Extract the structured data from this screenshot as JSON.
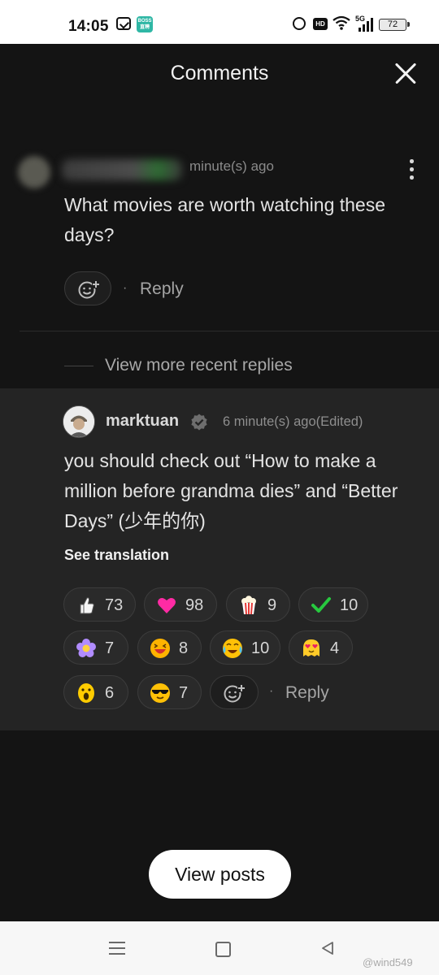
{
  "status_bar": {
    "time": "14:05",
    "boss_label": "BOSS 直聘",
    "hd_label": "HD",
    "signal_label": "5G",
    "battery": "72"
  },
  "header": {
    "title": "Comments"
  },
  "top_comment": {
    "time": "minute(s) ago",
    "text": "What movies are worth watching these days?",
    "reply_label": "Reply",
    "dot": "·"
  },
  "view_more": {
    "label": "View more recent replies"
  },
  "reply": {
    "username": "marktuan",
    "time": "6 minute(s) ago(Edited)",
    "text": "you should check out “How to make a million before grandma dies” and “Better Days” (少年的你)",
    "see_translation": "See translation",
    "reply_label": "Reply",
    "dot": "·",
    "reactions": [
      {
        "icon": "thumbs-up-icon",
        "count": "73"
      },
      {
        "icon": "heart-icon",
        "count": "98"
      },
      {
        "icon": "popcorn-icon",
        "count": "9"
      },
      {
        "icon": "check-mark-icon",
        "count": "10"
      },
      {
        "icon": "flower-icon",
        "count": "7"
      },
      {
        "icon": "laughing-face-icon",
        "count": "8"
      },
      {
        "icon": "crying-laughing-icon",
        "count": "10"
      },
      {
        "icon": "heart-eyes-ghost-icon",
        "count": "4"
      },
      {
        "icon": "surprised-face-icon",
        "count": "6"
      },
      {
        "icon": "sunglasses-face-icon",
        "count": "7"
      }
    ]
  },
  "view_posts": {
    "label": "View posts"
  },
  "watermark": "@wind549",
  "colors": {
    "background": "#141414",
    "reply_background": "#242424",
    "accent_white": "#ffffff"
  }
}
